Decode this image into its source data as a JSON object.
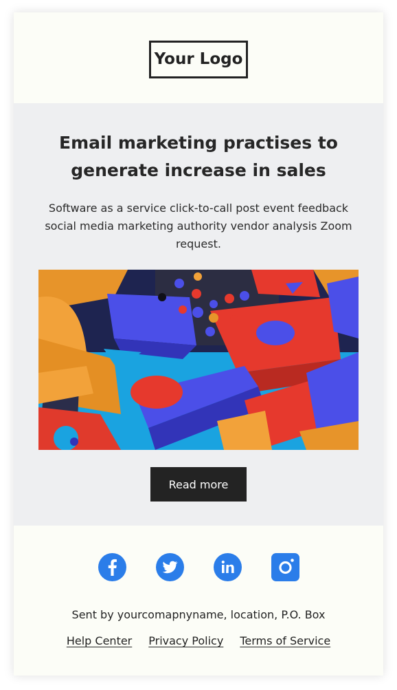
{
  "header": {
    "logo_text": "Your Logo"
  },
  "main": {
    "headline": "Email marketing practises to generate increase in sales",
    "body": "Software as a service click-to-call post event feedback social media marketing authority vendor analysis Zoom request.",
    "image_icon": "abstract-3d-blocks-image",
    "button_label": "Read more"
  },
  "footer": {
    "social": [
      {
        "icon": "facebook-icon"
      },
      {
        "icon": "twitter-icon"
      },
      {
        "icon": "linkedin-icon"
      },
      {
        "icon": "instagram-icon"
      }
    ],
    "sent_by": "Sent by yourcomapnyname, location, P.O. Box",
    "links": [
      "Help Center",
      "Privacy Policy",
      "Terms of Service"
    ]
  },
  "colors": {
    "background": "#fcfdf7",
    "section": "#eeeff1",
    "button": "#232323",
    "social_blue": "#2b7de9"
  }
}
